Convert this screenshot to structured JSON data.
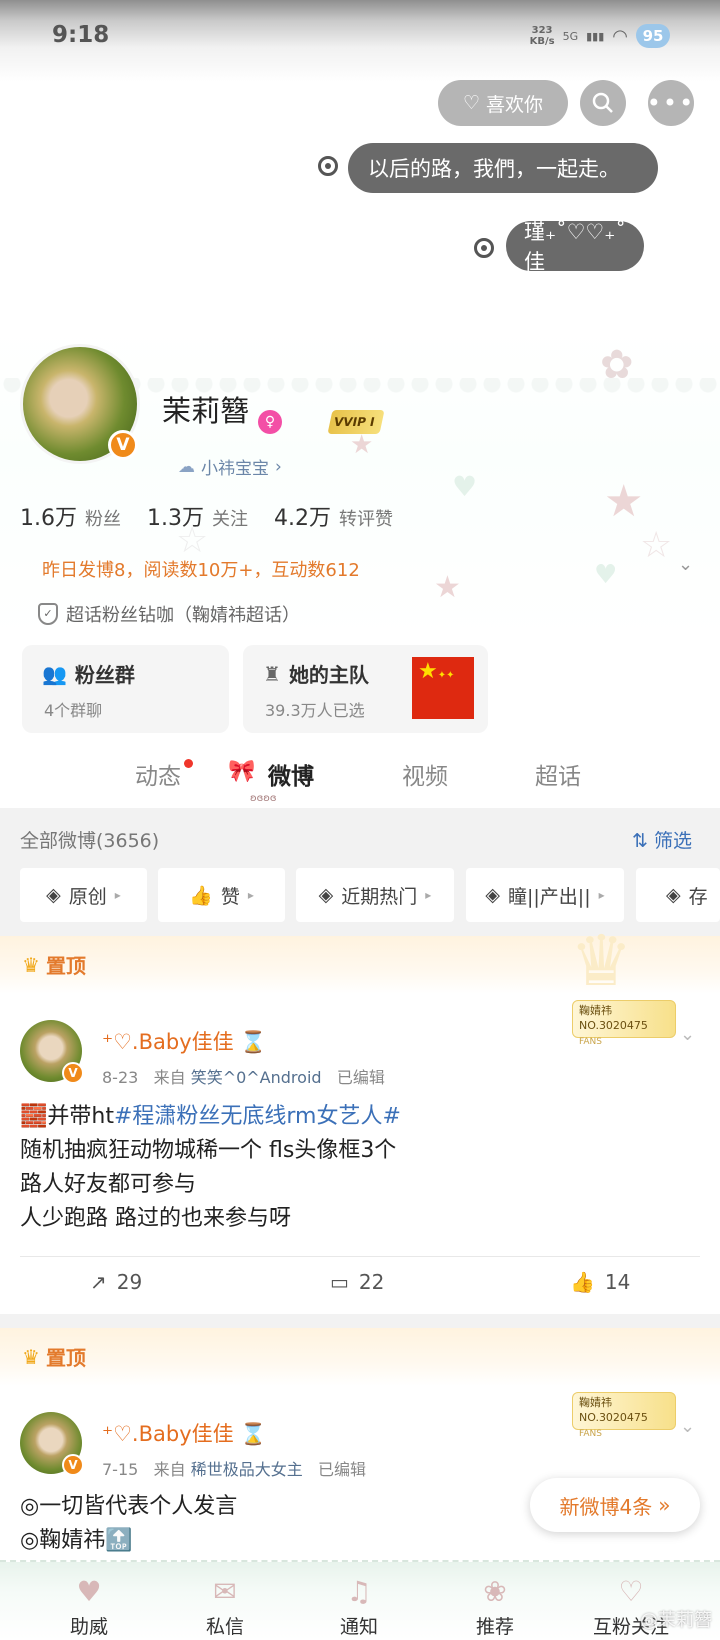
{
  "status_bar": {
    "time": "9:18",
    "speed_value": "323",
    "speed_unit": "KB/s",
    "network": "5G",
    "battery": "95"
  },
  "header": {
    "like_button": "喜欢你",
    "bubble_1": "以后的路，我們，一起走。",
    "bubble_2": "瑾₊˚♡♡₊˚佳"
  },
  "profile": {
    "name": "茉莉簪",
    "vip_label": "VVIP I",
    "fan_group_name": "小祎宝宝",
    "stats": [
      {
        "value": "1.6万",
        "label": "粉丝"
      },
      {
        "value": "1.3万",
        "label": "关注"
      },
      {
        "value": "4.2万",
        "label": "转评赞"
      }
    ],
    "yesterday_summary": "昨日发博8，阅读数10万+，互动数612",
    "supertopic": "超话粉丝钻咖（鞠婧祎超话）"
  },
  "cards": {
    "fan_group_title": "粉丝群",
    "fan_group_sub": "4个群聊",
    "team_title": "她的主队",
    "team_sub": "39.3万人已选"
  },
  "tabs": [
    "动态",
    "微博",
    "视频",
    "超话"
  ],
  "feed_header": {
    "all_weibo": "全部微博(3656)",
    "filter": "筛选",
    "chips": [
      "原创",
      "赞",
      "近期热门",
      "瞳||产出||",
      "存"
    ]
  },
  "posts": [
    {
      "pin_label": "置顶",
      "fans_badge_name": "鞠婧祎",
      "fans_badge_no": "NO.3020475",
      "fans_badge_tag": "FANS",
      "author": "⁺♡.Baby佳佳 ⌛",
      "date": "8-23",
      "from_label": "来自",
      "source": "笑笑^0^Android",
      "edited": "已编辑",
      "line_1_prefix": "🧱并带ht",
      "line_1_tag": "#程潇粉丝无底线rm女艺人#",
      "line_2": "随机抽疯狂动物城稀一个 fls头像框3个",
      "line_3": "路人好友都可参与",
      "line_4": "人少跑路 路过的也来参与呀",
      "reposts": "29",
      "comments": "22",
      "likes": "14"
    },
    {
      "pin_label": "置顶",
      "fans_badge_name": "鞠婧祎",
      "fans_badge_no": "NO.3020475",
      "fans_badge_tag": "FANS",
      "author": "⁺♡.Baby佳佳 ⌛",
      "date": "7-15",
      "from_label": "来自",
      "source": "稀世极品大女主",
      "edited": "已编辑",
      "line_1": "◎一切皆代表个人发言",
      "line_2": "◎鞠婧祎🔝"
    }
  ],
  "new_weibo": "新微博4条",
  "bottom_nav": [
    "助威",
    "私信",
    "通知",
    "推荐",
    "互粉关注"
  ],
  "watermark": "@茉莉簪",
  "colors": {
    "accent_orange": "#e37a2c",
    "link_blue": "#3b70b8",
    "vip_gold": "#e8c24a",
    "flag_red": "#de2910"
  }
}
